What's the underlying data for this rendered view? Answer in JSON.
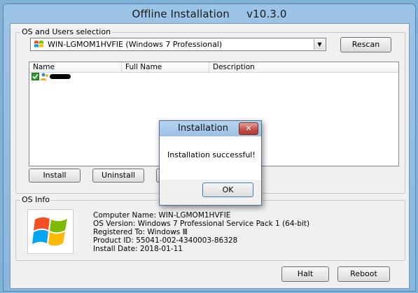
{
  "window": {
    "title": "Offline Installation",
    "version": "v10.3.0"
  },
  "os_selection": {
    "group_label": "OS and Users selection",
    "selected_os": "WIN-LGMOM1HVFIE (Windows 7 Professional)",
    "rescan_label": "Rescan"
  },
  "user_list": {
    "columns": [
      "Name",
      "Full Name",
      "Description"
    ],
    "rows": [
      {
        "name": "",
        "checked": true
      }
    ]
  },
  "actions": {
    "install_label": "Install",
    "uninstall_label": "Uninstall"
  },
  "os_info": {
    "group_label": "OS Info",
    "computer_name": "Computer Name: WIN-LGMOM1HVFIE",
    "os_version": "OS Version: Windows 7 Professional Service Pack 1 (64-bit)",
    "registered_to": "Registered To: Windows Ⅲ",
    "product_id": "Product ID: 55041-002-4340003-86328",
    "install_date": "Install Date: 2018-01-11"
  },
  "footer": {
    "halt_label": "Halt",
    "reboot_label": "Reboot"
  },
  "dialog": {
    "title": "Installation",
    "message": "Installation successful!",
    "ok_label": "OK",
    "close_glyph": "✕"
  },
  "colors": {
    "title_bar": "#9cc4e6",
    "dialog_close": "#c75050",
    "check_green": "#2e9b2e"
  }
}
